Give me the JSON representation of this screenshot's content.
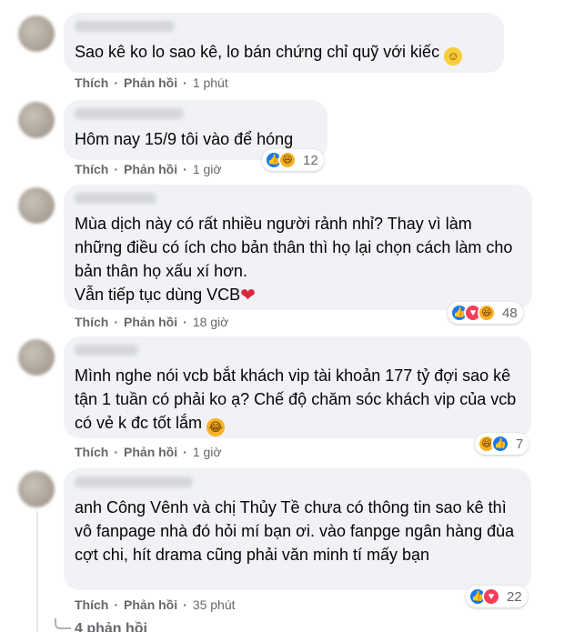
{
  "comments": [
    {
      "text": "Sao kê ko lo sao kê, lo bán chứng chỉ quỹ với kiếc",
      "trailing_emoji": "slightly-smiling-face",
      "like": "Thích",
      "reply": "Phản hồi",
      "time": "1 phút",
      "reactions": null
    },
    {
      "text": "Hôm nay 15/9 tôi vào để hóng",
      "like": "Thích",
      "reply": "Phản hồi",
      "time": "1 giờ",
      "reactions": {
        "icons": [
          "like",
          "haha"
        ],
        "count": "12"
      }
    },
    {
      "text": "Mùa dịch này có rất nhiều người rảnh nhỉ? Thay vì làm những điều có ích cho bản thân thì họ lại chọn cách làm cho bản thân họ xấu xí hơn.\nVẫn tiếp tục dùng VCB",
      "trailing_emoji": "red-heart",
      "like": "Thích",
      "reply": "Phản hồi",
      "time": "18 giờ",
      "reactions": {
        "icons": [
          "like",
          "love",
          "haha"
        ],
        "count": "48"
      }
    },
    {
      "text": "Mình nghe nói vcb bắt khách vip tài khoản 177 tỷ đợi sao kê tận 1 tuần có phải ko ạ? Chế độ chăm sóc khách vip của vcb có vẻ k đc tốt lắm",
      "trailing_emoji": "tears-of-joy",
      "like": "Thích",
      "reply": "Phản hồi",
      "time": "1 giờ",
      "reactions": {
        "icons": [
          "haha",
          "like"
        ],
        "count": "7"
      }
    },
    {
      "text": "anh Công Vênh và chị Thủy Tề chưa có thông tin sao kê thì vô fanpage nhà đó hỏi mí bạn ơi. vào fanpge ngân hàng đùa cợt chi, hít drama cũng phải văn minh tí mấy bạn",
      "like": "Thích",
      "reply": "Phản hồi",
      "time": "35 phút",
      "reactions": {
        "icons": [
          "like",
          "love"
        ],
        "count": "22"
      }
    }
  ],
  "more_replies": "4 phản hồi",
  "colors": {
    "bubble": "#f0f2f5",
    "meta": "#65676b",
    "like": "#1877f2",
    "love": "#f33e58",
    "haha": "#f7b125"
  }
}
